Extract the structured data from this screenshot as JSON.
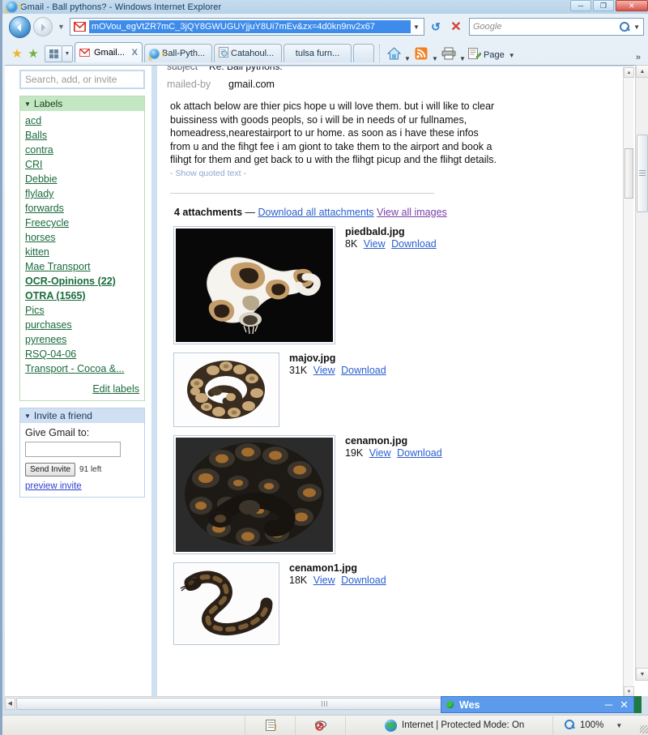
{
  "window": {
    "title": "Gmail - Ball pythons? - Windows Internet Explorer",
    "minimize": "─",
    "maximize": "❐",
    "close": "✕"
  },
  "address": {
    "url_text": "mOVou_egVtZR7mC_3jQY8GWUGUYjjuY8Ui7mEv&zx=4d0kn9nv2x67",
    "dropdown_caret": "▼",
    "refresh": "↺",
    "stop": "✕",
    "search_placeholder": "Google",
    "search_caret": "▼"
  },
  "tabs": {
    "favorites_label": "★",
    "add_favorite_label": "★",
    "quicktab_caret": "▼",
    "items": [
      {
        "label": "Gmail...",
        "close": "X",
        "active": true
      },
      {
        "label": "Ball-Pyth...",
        "active": false
      },
      {
        "label": "Catahoul...",
        "active": false
      },
      {
        "label": "tulsa furn...",
        "active": false
      },
      {
        "label": "",
        "active": false
      }
    ],
    "page_button": "Page",
    "caret": "▼",
    "overflow": "»"
  },
  "sidebar": {
    "search_placeholder": "Search, add, or invite",
    "labels_panel": {
      "title": "Labels",
      "collapse_caret": "▼",
      "items": [
        {
          "name": "acd",
          "bold": false
        },
        {
          "name": "Balls",
          "bold": false
        },
        {
          "name": "contra",
          "bold": false
        },
        {
          "name": "CRI",
          "bold": false
        },
        {
          "name": "Debbie",
          "bold": false
        },
        {
          "name": "flylady",
          "bold": false
        },
        {
          "name": "forwards",
          "bold": false
        },
        {
          "name": "Freecycle",
          "bold": false
        },
        {
          "name": "horses",
          "bold": false
        },
        {
          "name": "kitten",
          "bold": false
        },
        {
          "name": "Mae Transport",
          "bold": false
        },
        {
          "name": "OCR-Opinions (22)",
          "bold": true
        },
        {
          "name": "OTRA (1565)",
          "bold": true
        },
        {
          "name": "Pics",
          "bold": false
        },
        {
          "name": "purchases",
          "bold": false
        },
        {
          "name": "pyrenees",
          "bold": false
        },
        {
          "name": "RSQ-04-06",
          "bold": false
        },
        {
          "name": "Transport - Cocoa &...",
          "bold": false
        }
      ],
      "edit_labels": "Edit labels"
    },
    "invite_panel": {
      "title": "Invite a friend",
      "collapse_caret": "▼",
      "give_label": "Give Gmail to:",
      "input_value": "",
      "send_button": "Send Invite",
      "remaining": "91 left",
      "preview_link": "preview invite"
    }
  },
  "message": {
    "subject_key": "subject",
    "subject_value": "Re: Ball pythons:",
    "mailedby_key": "mailed-by",
    "mailedby_value": "gmail.com",
    "body": "ok attach below are thier pics hope u will love them. but i will like to clear buissiness with goods peopls, so i will be in needs of ur fullnames, homeadress,nearestairport to ur home. as soon as i have these infos from u and the fihgt fee i am giont to take them to the airport and book a flihgt for them and get back to u with the flihgt picup and the flihgt details.",
    "show_quoted": "- Show quoted text -"
  },
  "attachments": {
    "count_label": "4 attachments",
    "dash": "—",
    "download_all": "Download all attachments",
    "view_all": "View all images",
    "items": [
      {
        "filename": "piedbald.jpg",
        "size": "8K",
        "view": "View",
        "download": "Download",
        "kind": "piebald"
      },
      {
        "filename": "majov.jpg",
        "size": "31K",
        "view": "View",
        "download": "Download",
        "kind": "coiled-white"
      },
      {
        "filename": "cenamon.jpg",
        "size": "19K",
        "view": "View",
        "download": "Download",
        "kind": "dark-coiled"
      },
      {
        "filename": "cenamon1.jpg",
        "size": "18K",
        "view": "View",
        "download": "Download",
        "kind": "stretched"
      }
    ]
  },
  "chat": {
    "name": "Wes",
    "status": "online",
    "minimize": "─",
    "close": "✕"
  },
  "statusbar": {
    "zone": "Internet | Protected Mode: On",
    "zoom": "100%",
    "zoom_caret": "▼"
  },
  "scroll": {
    "up": "▲",
    "down": "▼",
    "left": "◀",
    "right": "▶"
  },
  "colors": {
    "accent_blue": "#3d8bea",
    "label_green": "#1a6b3c",
    "panel_green": "#c3e6c3",
    "panel_blue": "#cfe0f3",
    "link_blue": "#2b5fd0",
    "link_visited": "#7a3fa8",
    "chat_blue": "#5c9bec",
    "online_green": "#39c23f"
  }
}
